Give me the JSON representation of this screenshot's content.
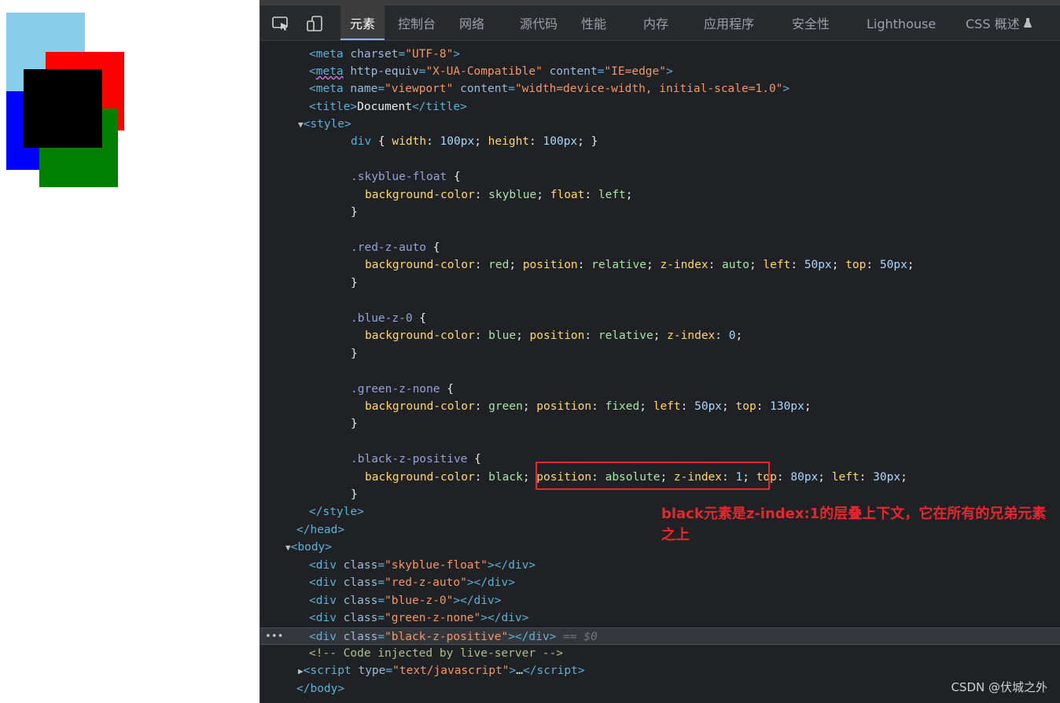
{
  "preview": {
    "colors": {
      "skyblue": "#87ceeb",
      "red": "#ff0000",
      "blue": "#0000ff",
      "green": "#008000",
      "black": "#000000"
    }
  },
  "devtools": {
    "tabs": [
      "元素",
      "控制台",
      "网络",
      "源代码",
      "性能",
      "内存",
      "应用程序",
      "安全性",
      "Lighthouse",
      "CSS 概述"
    ],
    "active_tab": "元素",
    "icons": [
      "inspect-element-icon",
      "device-toolbar-icon",
      "flask-icon"
    ]
  },
  "code": {
    "meta_charset": "\"UTF-8\"",
    "meta_xua": "\"X-UA-Compatible\"",
    "meta_edge": "\"IE=edge\"",
    "meta_viewport": "\"viewport\"",
    "meta_vp_content": "\"width=device-width, initial-scale=1.0\"",
    "title_text": "Document",
    "css_div": "div",
    "css_100": "100px",
    "cls_sky": ".skyblue-float",
    "cls_red": ".red-z-auto",
    "cls_blue": ".blue-z-0",
    "cls_green": ".green-z-none",
    "cls_black": ".black-z-positive",
    "v_skyblue": "skyblue",
    "v_left": "left",
    "v_red": "red",
    "v_relative": "relative",
    "v_auto": "auto",
    "v_50": "50px",
    "v_blue": "blue",
    "v_0": "0",
    "v_green": "green",
    "v_fixed": "fixed",
    "v_130": "130px",
    "v_black": "black",
    "v_absolute": "absolute",
    "v_1": "1",
    "v_80": "80px",
    "v_30": "30px",
    "b1": "\"skyblue-float\"",
    "b2": "\"red-z-auto\"",
    "b3": "\"blue-z-0\"",
    "b4": "\"green-z-none\"",
    "b5": "\"black-z-positive\"",
    "sel_marker": "== $0",
    "comment": "<!-- Code injected by live-server -->",
    "script_type": "\"text/javascript\"",
    "ellipsis": "…"
  },
  "annotation": "black元素是z-index:1的层叠上下文，它在所有的兄弟元素之上",
  "watermark": "CSDN @伏城之外"
}
